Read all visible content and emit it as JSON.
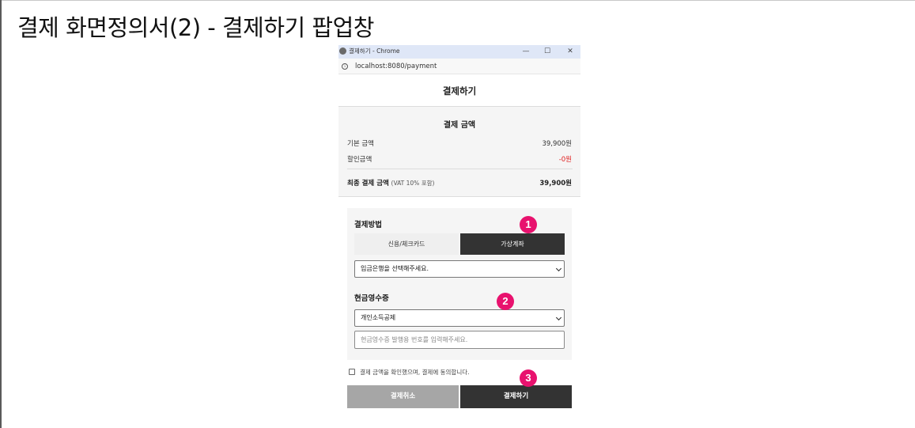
{
  "doc": {
    "title": "결제 화면정의서(2) - 결제하기 팝업창"
  },
  "window": {
    "title": "결제하기 - Chrome",
    "minimize_symbol": "—",
    "maximize_symbol": "☐",
    "close_symbol": "✕",
    "info_symbol": "i",
    "url": "localhost:8080/payment"
  },
  "page": {
    "heading": "결제하기"
  },
  "summary": {
    "title": "결제 금액",
    "base_label": "기본 금액",
    "base_value": "39,900원",
    "discount_label": "할인금액",
    "discount_value": "-0원",
    "total_label": "최종 결제 금액",
    "total_note": "(VAT 10% 포함)",
    "total_value": "39,900원"
  },
  "payment_method": {
    "title": "결제방법",
    "tabs": [
      {
        "label": "신용/체크카드",
        "selected": false
      },
      {
        "label": "가상계좌",
        "selected": true
      }
    ],
    "bank_select_value": "입금은행을 선택해주세요."
  },
  "cash_receipt": {
    "title": "현금영수증",
    "type_select_value": "개인소득공제",
    "number_placeholder": "현금영수증 발행용 번호를 입력해주세요."
  },
  "agreement": {
    "label": "결제 금액을 확인했으며, 결제에 동의합니다.",
    "checked": false
  },
  "buttons": {
    "cancel_label": "결제취소",
    "pay_label": "결제하기"
  },
  "markers": [
    "1",
    "2",
    "3"
  ],
  "colors": {
    "accent_dark": "#333333",
    "marker": "#e8126e",
    "discount": "#e02222",
    "cancel_button": "#a6a6a6"
  }
}
